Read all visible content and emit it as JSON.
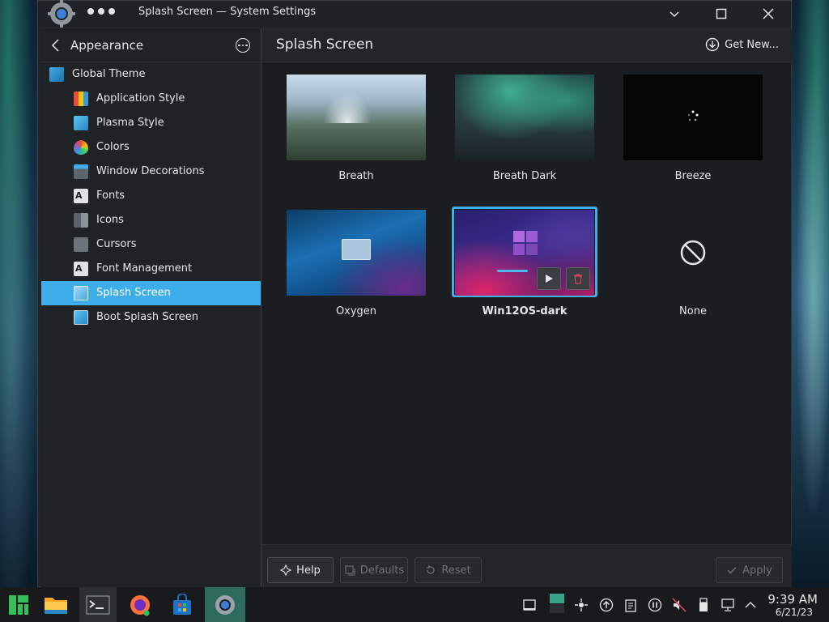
{
  "window": {
    "title": "Splash Screen — System Settings"
  },
  "sidebar": {
    "title": "Appearance",
    "items": [
      {
        "label": "Global Theme",
        "icon": "global-theme-icon"
      },
      {
        "label": "Application Style",
        "icon": "application-style-icon"
      },
      {
        "label": "Plasma Style",
        "icon": "plasma-style-icon"
      },
      {
        "label": "Colors",
        "icon": "colors-icon"
      },
      {
        "label": "Window Decorations",
        "icon": "window-decorations-icon"
      },
      {
        "label": "Fonts",
        "icon": "fonts-icon"
      },
      {
        "label": "Icons",
        "icon": "icons-icon"
      },
      {
        "label": "Cursors",
        "icon": "cursors-icon"
      },
      {
        "label": "Font Management",
        "icon": "font-management-icon"
      },
      {
        "label": "Splash Screen",
        "icon": "splash-screen-icon",
        "active": true
      },
      {
        "label": "Boot Splash Screen",
        "icon": "boot-splash-icon"
      }
    ]
  },
  "main": {
    "title": "Splash Screen",
    "get_new_label": "Get New...",
    "themes": [
      {
        "label": "Breath"
      },
      {
        "label": "Breath Dark"
      },
      {
        "label": "Breeze"
      },
      {
        "label": "Oxygen"
      },
      {
        "label": "Win12OS-dark",
        "selected": true
      },
      {
        "label": "None"
      }
    ]
  },
  "footer": {
    "help_label": "Help",
    "defaults_label": "Defaults",
    "reset_label": "Reset",
    "apply_label": "Apply"
  },
  "taskbar": {
    "time": "9:39 AM",
    "date": "6/21/23"
  },
  "colors": {
    "accent": "#3daee9",
    "window_bg": "#232629",
    "grid_bg": "#1b1e20"
  }
}
